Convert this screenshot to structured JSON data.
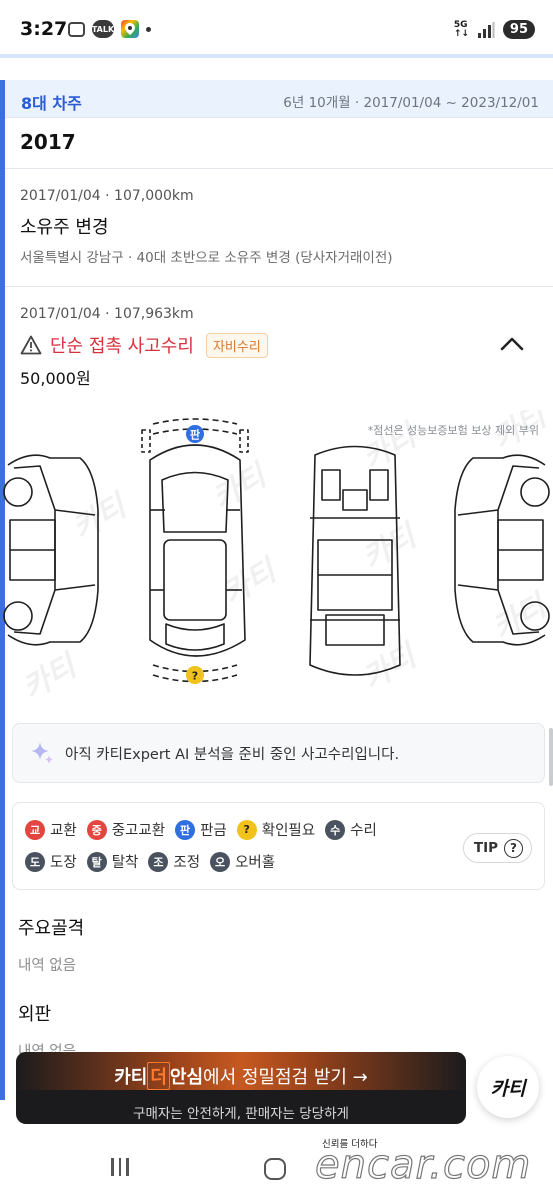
{
  "status_bar": {
    "time": "3:27",
    "net": "5G",
    "battery": "95",
    "talk": "TALK"
  },
  "owner": {
    "title": "8대 차주",
    "period": "6년 10개월 · 2017/01/04 ~ 2023/12/01"
  },
  "year": "2017",
  "events": [
    {
      "meta": "2017/01/04 · 107,000km",
      "title": "소유주 변경",
      "sub": "서울특별시 강남구 · 40대 초반으로 소유주 변경 (당사자거래이전)"
    }
  ],
  "accident": {
    "meta": "2017/01/04 · 107,963km",
    "title": "단순 접촉 사고수리",
    "badge": "자비수리",
    "price": "50,000원",
    "note": "*점선은 성능보증보험 보상 제외 부위",
    "markers": {
      "panel": "판",
      "check": "?"
    }
  },
  "ai_box": {
    "text": "아직 카티Expert AI 분석을 준비 중인 사고수리입니다."
  },
  "legend": {
    "row1": [
      {
        "sym": "교",
        "label": "교환",
        "color": "#e2463f"
      },
      {
        "sym": "중",
        "label": "중고교환",
        "color": "#e2463f"
      },
      {
        "sym": "판",
        "label": "판금",
        "color": "#2f6fe0"
      },
      {
        "sym": "?",
        "label": "확인필요",
        "color": "#f1c21b"
      },
      {
        "sym": "수",
        "label": "수리",
        "color": "#4a5260"
      }
    ],
    "row2": [
      {
        "sym": "도",
        "label": "도장",
        "color": "#4a5260"
      },
      {
        "sym": "탈",
        "label": "탈착",
        "color": "#4a5260"
      },
      {
        "sym": "조",
        "label": "조정",
        "color": "#4a5260"
      },
      {
        "sym": "오",
        "label": "오버홀",
        "color": "#4a5260"
      }
    ],
    "tip": "TIP",
    "tip_q": "?"
  },
  "sections": [
    {
      "title": "주요골격",
      "empty": "내역 없음"
    },
    {
      "title": "외판",
      "empty": "내역 없음"
    }
  ],
  "banner": {
    "brand_a": "카티",
    "brand_box": "더",
    "brand_b": "안심",
    "rest": "에서 정밀점검 받기 →",
    "sub": "구매자는 안전하게, 판매자는 당당하게"
  },
  "fab_label": "카티",
  "trust": "신뢰를 더하다",
  "watermark": "encar.com"
}
